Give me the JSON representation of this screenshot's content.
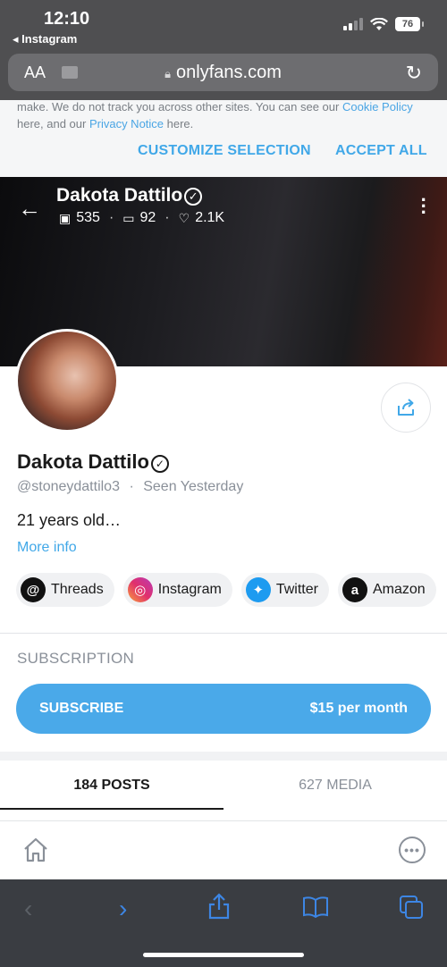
{
  "status_bar": {
    "time": "12:10",
    "back_app": "◂ Instagram",
    "battery": "76"
  },
  "url_bar": {
    "aa": "AA",
    "url": "onlyfans.com"
  },
  "cookie": {
    "text_prefix": "make. We do not track you across other sites. You can see our ",
    "cookie_policy": "Cookie Policy",
    "text_mid": " here, and our ",
    "privacy_notice": "Privacy Notice",
    "text_suffix": " here.",
    "customize": "CUSTOMIZE SELECTION",
    "accept": "ACCEPT ALL"
  },
  "header": {
    "name": "Dakota Dattilo",
    "photos": "535",
    "videos": "92",
    "likes": "2.1K"
  },
  "profile": {
    "name": "Dakota Dattilo",
    "handle": "@stoneydattilo3",
    "seen": "Seen  Yesterday",
    "bio": "21 years old…",
    "more_info": "More info"
  },
  "socials": [
    {
      "label": "Threads",
      "icon": "threads-icon"
    },
    {
      "label": "Instagram",
      "icon": "instagram-icon"
    },
    {
      "label": "Twitter",
      "icon": "twitter-icon"
    },
    {
      "label": "Amazon",
      "icon": "amazon-icon"
    }
  ],
  "subscription": {
    "title": "SUBSCRIPTION",
    "button": "SUBSCRIBE",
    "price": "$15 per month"
  },
  "tabs": {
    "posts": "184 POSTS",
    "media": "627 MEDIA"
  },
  "colors": {
    "accent": "#4aa9e9",
    "muted": "#8a9099"
  }
}
